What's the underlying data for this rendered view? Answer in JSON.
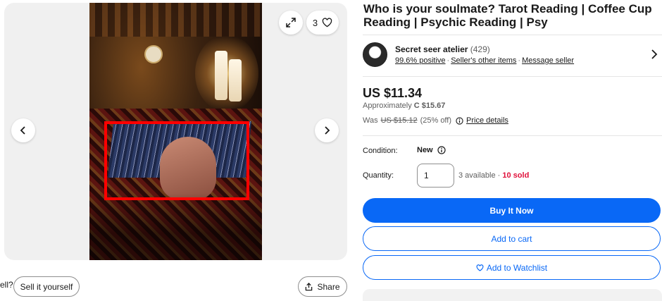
{
  "gallery": {
    "like_count": "3",
    "icons": {
      "expand": "expand-icon",
      "heart": "heart-icon",
      "prev": "chevron-left-icon",
      "next": "chevron-right-icon",
      "share": "share-icon"
    }
  },
  "below_gallery": {
    "cut_text": "ell?",
    "sell_label": "Sell it yourself",
    "share_label": "Share"
  },
  "listing": {
    "title": "Who is your soulmate? Tarot Reading | Coffee Cup Reading | Psychic Reading | Psy"
  },
  "seller": {
    "name": "Secret seer atelier",
    "count": "(429)",
    "positive": "99.6% positive",
    "other_items": "Seller's other items",
    "message": "Message seller"
  },
  "pricing": {
    "price": "US $11.34",
    "approx_prefix": "Approximately",
    "approx_value": "C $15.67",
    "was_prefix": "Was",
    "was_value": "US $15.12",
    "discount": "(25% off)",
    "details_link": "Price details"
  },
  "details": {
    "condition_label": "Condition:",
    "condition_value": "New",
    "quantity_label": "Quantity:",
    "quantity_value": "1",
    "available": "3 available ·",
    "sold": "10 sold"
  },
  "actions": {
    "buy_now": "Buy It Now",
    "add_to_cart": "Add to cart",
    "watchlist": "Add to Watchlist"
  },
  "colors": {
    "accent": "#0968f6",
    "sold": "#e0103a",
    "highlight": "#ff0000"
  }
}
